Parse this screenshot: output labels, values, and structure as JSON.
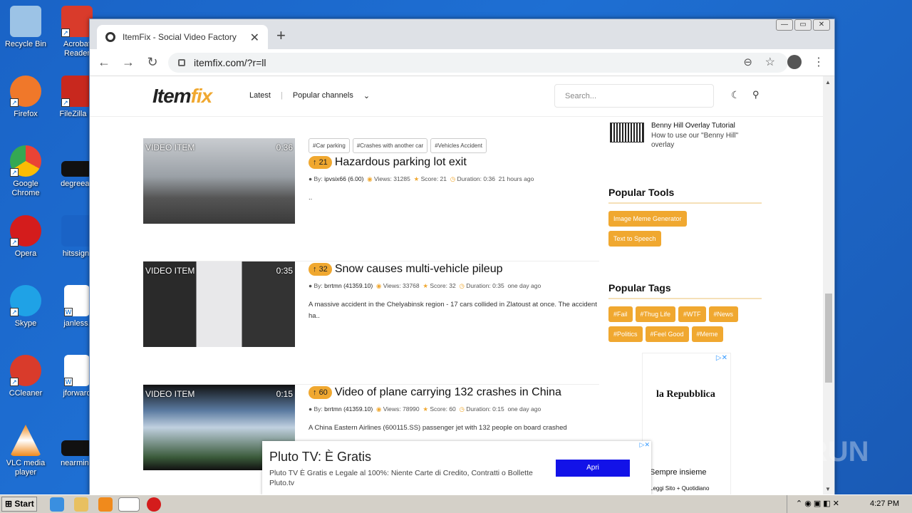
{
  "desktop": {
    "icons": [
      {
        "label": "Recycle Bin",
        "color": "#9cc3e6"
      },
      {
        "label": "Acrobat Reader",
        "color": "#d93b2b"
      },
      {
        "label": "Firefox",
        "color": "#f0782a"
      },
      {
        "label": "FileZilla C",
        "color": "#c8281e"
      },
      {
        "label": "Google Chrome",
        "color": "#34a853"
      },
      {
        "label": "degreeac",
        "color": "#111111"
      },
      {
        "label": "Opera",
        "color": "#d41c1c"
      },
      {
        "label": "hitssign.",
        "color": "#1a63c6"
      },
      {
        "label": "Skype",
        "color": "#1fa2e6"
      },
      {
        "label": "janless.",
        "color": "#ffffff"
      },
      {
        "label": "CCleaner",
        "color": "#d93b2b"
      },
      {
        "label": "jforward",
        "color": "#ffffff"
      },
      {
        "label": "VLC media player",
        "color": "#f08a1c"
      },
      {
        "label": "nearminu",
        "color": "#111111"
      }
    ]
  },
  "browser": {
    "tab_title": "ItemFix - Social Video Factory",
    "tab_close": "✕",
    "new_tab": "+",
    "url": "itemfix.com/?r=ll",
    "win_min": "—",
    "win_max": "▭",
    "win_close": "✕"
  },
  "site": {
    "logo_a": "Item",
    "logo_b": "fix",
    "nav": {
      "latest": "Latest",
      "popular": "Popular channels"
    },
    "search_placeholder": "Search...",
    "items": [
      {
        "label": "VIDEO ITEM",
        "duration": "0:36",
        "tags": [
          "#Car parking",
          "#Crashes with another car",
          "#Vehicles Accident"
        ],
        "score": "21",
        "title": "Hazardous parking lot exit",
        "by_label": "By:",
        "author": "ipvsix66 (6.00)",
        "views": "Views: 31285",
        "score_text": "Score: 21",
        "duration_text": "Duration: 0:36",
        "age": "21 hours ago",
        "desc": ".."
      },
      {
        "label": "VIDEO ITEM",
        "duration": "0:35",
        "tags": [],
        "score": "32",
        "title": "Snow causes multi-vehicle pileup",
        "by_label": "By:",
        "author": "brrtmn (41359.10)",
        "views": "Views: 33768",
        "score_text": "Score: 32",
        "duration_text": "Duration: 0:35",
        "age": "one day ago",
        "desc": "A massive accident in the Chelyabinsk region - 17 cars collided in Zlatoust at once. The accident ha.."
      },
      {
        "label": "VIDEO ITEM",
        "duration": "0:15",
        "tags": [],
        "score": "60",
        "title": "Video of plane carrying 132 crashes in China",
        "by_label": "By:",
        "author": "brrtmn (41359.10)",
        "views": "Views: 78990",
        "score_text": "Score: 60",
        "duration_text": "Duration: 0:15",
        "age": "one day ago",
        "desc": "A China Eastern Airlines (600115.SS) passenger jet with 132 people on board crashed"
      }
    ],
    "sidebar": {
      "tutorial_title": "Benny Hill Overlay Tutorial",
      "tutorial_desc": "How to use our \"Benny Hill\" overlay",
      "tools_heading": "Popular Tools",
      "tools": [
        "Image Meme Generator",
        "Text to Speech"
      ],
      "tags_heading": "Popular Tags",
      "tags": [
        "#Fail",
        "#Thug Life",
        "#WTF",
        "#News",
        "#Politics",
        "#Feel Good",
        "#Meme"
      ]
    },
    "ad_side": {
      "brand": "la Repubblica",
      "line1": "Sempre insieme",
      "line2": "Leggi Sito + Quotidiano"
    },
    "ad_bottom": {
      "headline": "Pluto TV: È Gratis",
      "text": "Pluto TV È Gratis e Legale al 100%: Niente Carte di Credito, Contratti o Bollette Pluto.tv",
      "cta": "Apri"
    }
  },
  "taskbar": {
    "start": "Start",
    "clock": "4:27 PM"
  },
  "watermark": "ANY RUN"
}
